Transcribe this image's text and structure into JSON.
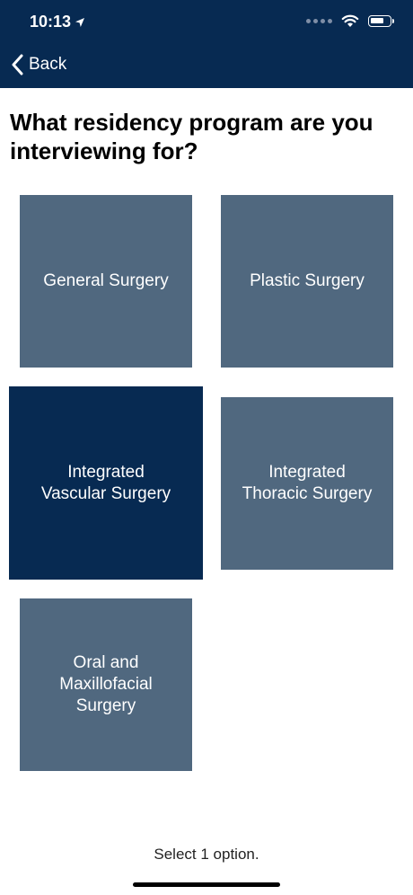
{
  "status_bar": {
    "time": "10:13"
  },
  "nav": {
    "back_label": "Back"
  },
  "question": "What residency program are you interviewing for?",
  "options": [
    {
      "label": "General Surgery",
      "selected": false
    },
    {
      "label": "Plastic Surgery",
      "selected": false
    },
    {
      "label": "Integrated\nVascular Surgery",
      "selected": true
    },
    {
      "label": "Integrated\nThoracic Surgery",
      "selected": false
    },
    {
      "label": "Oral and\nMaxillofacial\nSurgery",
      "selected": false
    }
  ],
  "hint": "Select 1 option.",
  "colors": {
    "header": "#072a52",
    "tile": "#50687f",
    "tile_selected": "#072a52"
  }
}
